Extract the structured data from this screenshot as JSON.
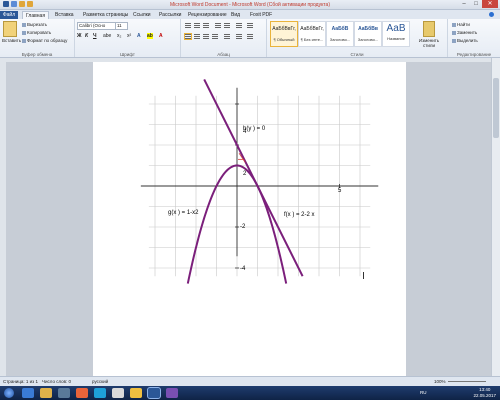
{
  "window": {
    "title": "Microsoft Word Document - Microsoft Word (Сбой активации продукта)"
  },
  "tabs": [
    "Файл",
    "Главная",
    "Вставка",
    "Разметка страницы",
    "Ссылки",
    "Рассылки",
    "Рецензирование",
    "Вид",
    "Foxit PDF"
  ],
  "clipboard": {
    "paste": "Вставить",
    "cut": "Вырезать",
    "copy": "Копировать",
    "format_painter": "Формат по образцу",
    "label": "Буфер обмена"
  },
  "font": {
    "name": "Calibri (Осно",
    "size": "11",
    "label": "Шрифт"
  },
  "paragraph": {
    "label": "Абзац"
  },
  "styles": {
    "label": "Стили",
    "items": [
      {
        "sample": "АаБбВвГг,",
        "name": "¶ Обычный"
      },
      {
        "sample": "АаБбВвГг,",
        "name": "¶ Без инте..."
      },
      {
        "sample": "АаБбВ",
        "name": "Заголово..."
      },
      {
        "sample": "АаБбВв",
        "name": "Заголово..."
      },
      {
        "sample": "АаВ",
        "name": "Название"
      }
    ],
    "change_styles": "Изменить стили"
  },
  "editing": {
    "find": "Найти",
    "replace": "Заменить",
    "select": "Выделить",
    "label": "Редактирование"
  },
  "graph": {
    "labels": {
      "h": "h(y ) = 0",
      "g": "g(x ) = 1-x2",
      "f": "f(x ) = 2-2 x"
    },
    "y_ticks": [
      "4",
      "2",
      "-2",
      "-4"
    ],
    "x_ticks": [
      "5"
    ]
  },
  "chart_data": {
    "type": "line",
    "series": [
      {
        "name": "g(x ) = 1-x2",
        "formula": "1 - x^2",
        "x": [
          -2.4,
          -2,
          -1.5,
          -1,
          -0.5,
          0,
          0.5,
          1,
          1.5,
          2,
          2.4
        ],
        "y": [
          -4.76,
          -3,
          -1.25,
          0,
          0.75,
          1,
          0.75,
          0,
          -1.25,
          -3,
          -4.76
        ]
      },
      {
        "name": "f(x ) = 2-2 x",
        "formula": "2 - 2x",
        "x": [
          -1.6,
          3.2
        ],
        "y": [
          5.2,
          -4.4
        ]
      }
    ],
    "xlim": [
      -4.3,
      6.5
    ],
    "ylim": [
      -4.4,
      4.4
    ],
    "colors": {
      "curve": "#7b1f7b",
      "grid": "#c8c8c8",
      "axis": "#333333"
    }
  },
  "status": {
    "page": "Страница: 1 из 1",
    "words": "Число слов: 0",
    "lang": "русский",
    "zoom": "100%"
  },
  "tray": {
    "lang": "RU",
    "time": "13:40",
    "date": "22.05.2017"
  }
}
